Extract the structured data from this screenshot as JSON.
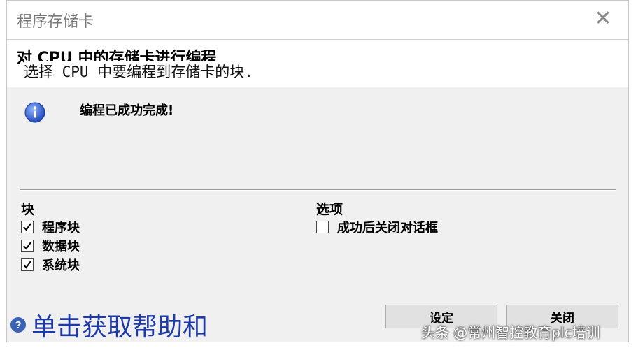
{
  "window": {
    "title": "程序存储卡",
    "close_glyph": "✕"
  },
  "header": {
    "title": "对 CPU 中的存储卡进行编程",
    "subtitle": "选择 CPU 中要编程到存储卡的块."
  },
  "status": {
    "icon": "info-icon",
    "message": "编程已成功完成!"
  },
  "blocks": {
    "title": "块",
    "items": [
      {
        "label": "程序块",
        "checked": true
      },
      {
        "label": "数据块",
        "checked": true
      },
      {
        "label": "系统块",
        "checked": true
      }
    ]
  },
  "options": {
    "title": "选项",
    "items": [
      {
        "label": "成功后关闭对话框",
        "checked": false
      }
    ]
  },
  "help": {
    "icon": "help-icon",
    "label": "单击获取帮助和"
  },
  "buttons": {
    "settings": "设定",
    "close": "关闭"
  },
  "watermark": "头条 @常州智控教育plc培训"
}
